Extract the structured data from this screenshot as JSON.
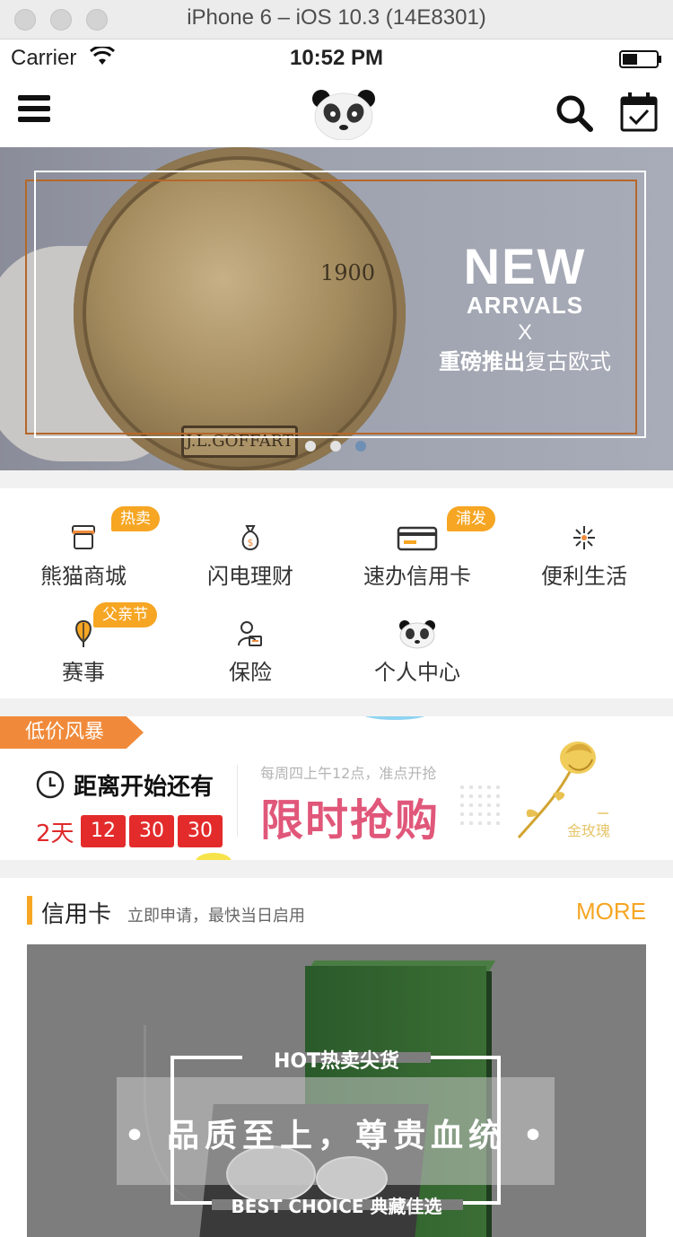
{
  "simulator": {
    "title": "iPhone 6 – iOS 10.3 (14E8301)"
  },
  "status_bar": {
    "carrier": "Carrier",
    "time": "10:52 PM"
  },
  "navbar": {
    "menu_icon": "hamburger-icon",
    "logo_icon": "panda-icon",
    "search_icon": "search-icon",
    "calendar_icon": "calendar-check-icon"
  },
  "banner": {
    "coin_year": "1900",
    "coin_plate": "J.L.GOFFART",
    "headline": "NEW",
    "subheadline": "ARRVALS",
    "cross": "X",
    "tag_bold": "重磅推出",
    "tag_rest": "复古欧式",
    "slide_count": 3,
    "active_slide": 3
  },
  "grid": {
    "items": [
      {
        "label": "熊猫商城",
        "badge": "热卖",
        "icon": "shop-icon"
      },
      {
        "label": "闪电理财",
        "badge": "",
        "icon": "money-bag-icon"
      },
      {
        "label": "速办信用卡",
        "badge": "浦发",
        "icon": "credit-card-icon"
      },
      {
        "label": "便利生活",
        "badge": "",
        "icon": "sparkle-icon"
      },
      {
        "label": "赛事",
        "badge": "父亲节",
        "icon": "balloon-icon"
      },
      {
        "label": "保险",
        "badge": "",
        "icon": "insurance-icon"
      },
      {
        "label": "个人中心",
        "badge": "",
        "icon": "panda-icon"
      }
    ]
  },
  "flash_sale": {
    "tag": "低价风暴",
    "countdown_title": "距离开始还有",
    "days": "2天",
    "hours": "12",
    "minutes": "30",
    "seconds": "30",
    "schedule": "每周四上午12点，准点开抢",
    "headline": "限时抢购",
    "product": "金玫瑰"
  },
  "credit_card": {
    "title": "信用卡",
    "subtitle": "立即申请，最快当日启用",
    "more": "MORE",
    "promo_hot": "HOT热卖尖货",
    "promo_main": "• 品质至上，尊贵血统 •",
    "promo_best": "BEST CHOICE 典藏佳选"
  },
  "colors": {
    "accent": "#f6a623",
    "sale_red": "#e42b2b",
    "headline_pink": "#e0577a",
    "banner_dot_active": "#6f8fb4"
  }
}
